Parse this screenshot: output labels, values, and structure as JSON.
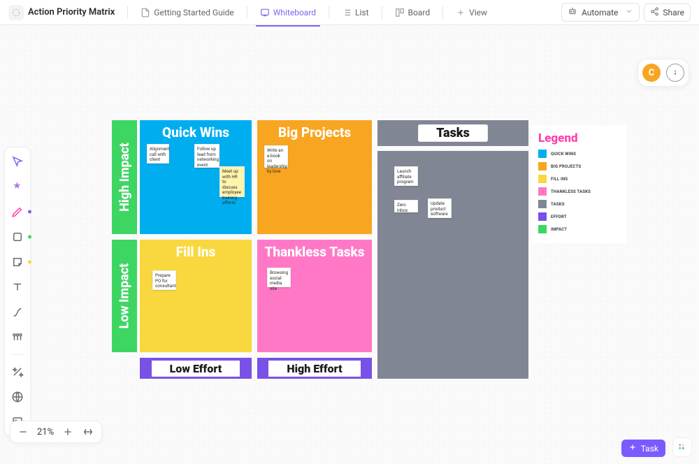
{
  "header": {
    "title": "Action Priority Matrix",
    "nav": {
      "getting_started": "Getting Started Guide",
      "whiteboard": "Whiteboard",
      "list": "List",
      "board": "Board",
      "view": "View"
    },
    "automate": "Automate",
    "share": "Share"
  },
  "avatar": {
    "initial": "C"
  },
  "board": {
    "impact_high": "High Impact",
    "impact_low": "Low Impact",
    "effort_low": "Low Effort",
    "effort_high": "High Effort",
    "tasks_title": "Tasks",
    "quadrants": {
      "quick_wins": "Quick Wins",
      "big_projects": "Big Projects",
      "fill_ins": "Fill Ins",
      "thankless": "Thankless Tasks"
    },
    "notes": {
      "quick_wins": [
        "Alignment call with client",
        "Follow up lead from networking event",
        "Meet up with HR to discuss employee training efforts"
      ],
      "big_projects": [
        "Write an e-book on leadership by love"
      ],
      "fill_ins": [
        "Prepare PO for consultant"
      ],
      "thankless": [
        "Browsing social media site"
      ],
      "tasks": [
        "Launch affiliate program",
        "Zero inbox",
        "Update product software"
      ]
    }
  },
  "legend": {
    "title": "Legend",
    "items": [
      {
        "label": "QUICK WINS",
        "color": "#00aef0"
      },
      {
        "label": "BIG PROJECTS",
        "color": "#f8a521"
      },
      {
        "label": "FILL INS",
        "color": "#f9d83f"
      },
      {
        "label": "THANKLESS TASKS",
        "color": "#ff78c6"
      },
      {
        "label": "TASKS",
        "color": "#818695"
      },
      {
        "label": "EFFORT",
        "color": "#7851e6"
      },
      {
        "label": "IMPACT",
        "color": "#3ed663"
      }
    ]
  },
  "zoom": {
    "percent": "21%"
  },
  "fab": {
    "task": "Task"
  }
}
